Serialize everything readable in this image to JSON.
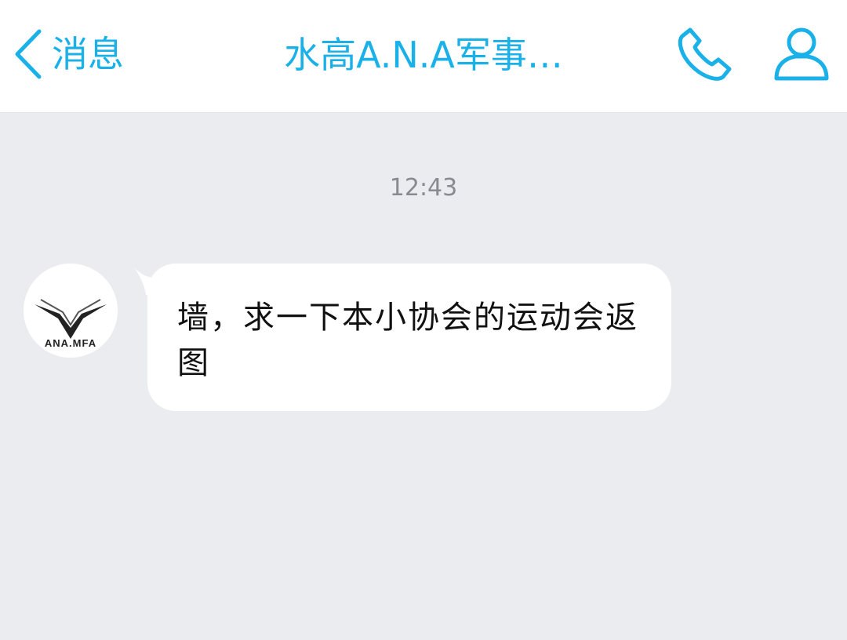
{
  "header": {
    "back_label": "消息",
    "title": "水高A.N.A军事…",
    "accent_color": "#1ab0e8",
    "icons": {
      "back": "chevron-left-icon",
      "phone": "phone-icon",
      "profile": "profile-icon"
    }
  },
  "chat": {
    "timestamp": "12:43",
    "messages": [
      {
        "sender_avatar_text": "ANA.MFA",
        "text": "墙，求一下本小协会的运动会返图"
      }
    ]
  }
}
